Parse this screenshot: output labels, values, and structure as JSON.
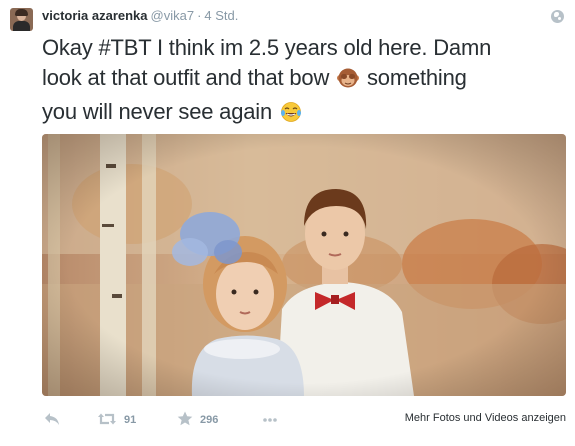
{
  "tweet": {
    "author_name": "victoria azarenka",
    "handle": "@vika7",
    "separator": "·",
    "time": "4 Std.",
    "text_line1": "Okay #TBT I think im 2.5 years old here. Damn",
    "text_line2_a": "look at that outfit and that bow",
    "text_line2_b": "something",
    "text_line3": "you will never see again",
    "emoji_1": "see-no-evil-monkey",
    "emoji_2": "face-with-tears-of-joy"
  },
  "actions": {
    "retweet_count": "91",
    "favorite_count": "296",
    "media_link": "Mehr Fotos und Videos anzeigen"
  },
  "icons": {
    "reply": "reply-icon",
    "retweet": "retweet-icon",
    "favorite": "star-icon",
    "more": "more-icon",
    "globe": "globe-icon"
  },
  "colors": {
    "text": "#292f33",
    "muted": "#8899a6",
    "icon": "#b7c1c8"
  }
}
